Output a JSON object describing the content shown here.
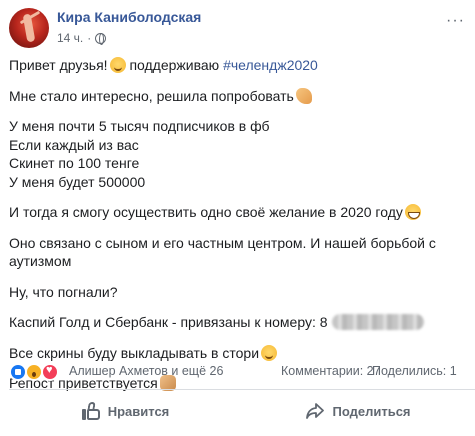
{
  "post": {
    "author_name": "Кира Каниболодская",
    "time": "14 ч.",
    "time_separator": "·",
    "more_glyph": "···",
    "lines": {
      "l1_text": "Привет друзья!",
      "l1_support": " поддерживаю ",
      "l1_hashtag": "#челендж2020",
      "l2": "Мне стало интересно, решила попробовать",
      "l3a": "У меня почти 5 тысяч подписчиков в фб",
      "l3b": "Если каждый из вас",
      "l3c": "Скинет по 100 тенге",
      "l3d": "У меня будет 500000",
      "l4": "И тогда я смогу осуществить одно своё желание в 2020 году",
      "l5": "Оно связано с сыном и его частным центром. И нашей борьбой с аутизмом",
      "l6": "Ну, что погнали?",
      "l7": "Каспий Голд и Сбербанк - привязаны к номеру: 8",
      "l8": "Все скрины буду выкладывать в стори",
      "l9": "Репост приветствуется"
    },
    "emojis": [
      "blush-emoji",
      "flexed-arm-emoji",
      "grinning-emoji",
      "smiling-emoji",
      "handshake-emoji"
    ]
  },
  "stats": {
    "reactors": "Алишер Ахметов и ещё 26",
    "comments": "Комментарии: 27",
    "shares": "Поделились: 1"
  },
  "actions": {
    "like_label": "Нравится",
    "share_label": "Поделиться"
  },
  "colors": {
    "link": "#385898",
    "muted": "#606770",
    "like_blue": "#1877f2",
    "wow_yellow": "#f7b125",
    "love_red": "#f33e58"
  }
}
